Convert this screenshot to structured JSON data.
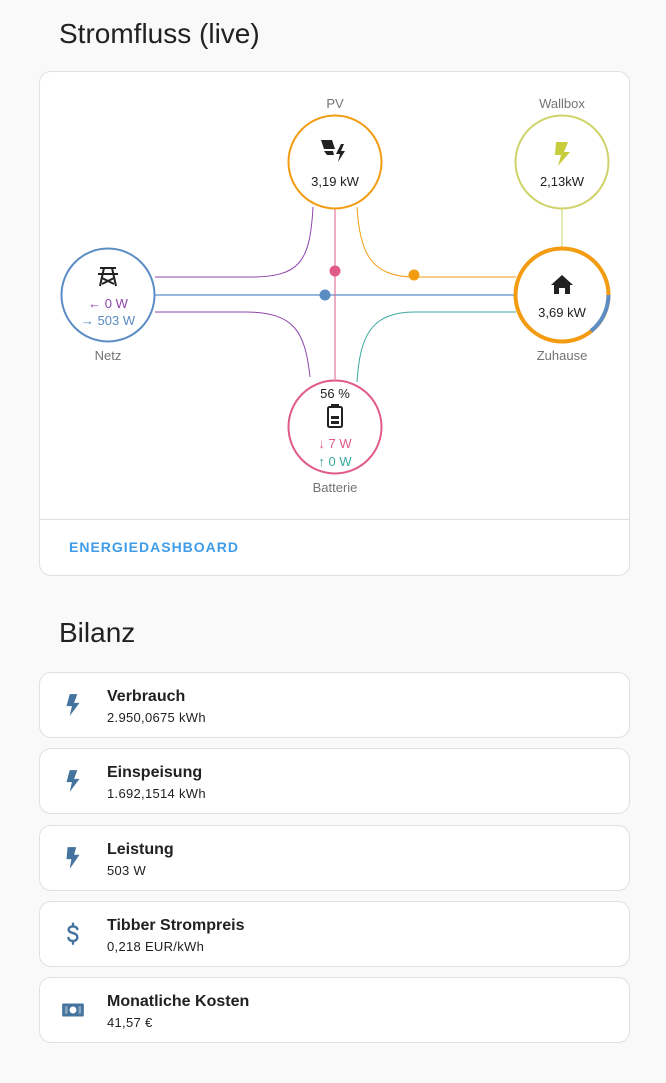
{
  "flow_section": {
    "title": "Stromfluss (live)"
  },
  "energy_flow": {
    "pv": {
      "label": "PV",
      "value": "3,19 kW",
      "color": "#f39c12"
    },
    "wallbox": {
      "label": "Wallbox",
      "value": "2,13kW",
      "color": "#cfd36a"
    },
    "grid": {
      "label": "Netz",
      "import_value": "0 W",
      "export_value": "503 W",
      "color": "#5b8cc4"
    },
    "home": {
      "label": "Zuhause",
      "value": "3,69 kW",
      "color": "#f39c12"
    },
    "battery": {
      "label": "Batterie",
      "soc": "56 %",
      "in_value": "7 W",
      "out_value": "0 W",
      "color": "#e05a8a"
    },
    "colors": {
      "solar_to_grid": "#8e44ad",
      "battery_to_home": "#3aa99f",
      "grid_to_home": "#5b8cc4"
    },
    "dashboard_link": "Energiedashboard"
  },
  "balance_section": {
    "title": "Bilanz"
  },
  "entities": [
    {
      "name": "Verbrauch",
      "state": "2.950,0675 kWh",
      "icon": "flash-icon"
    },
    {
      "name": "Einspeisung",
      "state": "1.692,1514 kWh",
      "icon": "flash-icon"
    },
    {
      "name": "Leistung",
      "state": "503 W",
      "icon": "flash-bold-icon"
    },
    {
      "name": "Tibber Strompreis",
      "state": "0,218 EUR/kWh",
      "icon": "dollar-icon"
    },
    {
      "name": "Monatliche Kosten",
      "state": "41,57 €",
      "icon": "cash-icon"
    }
  ]
}
